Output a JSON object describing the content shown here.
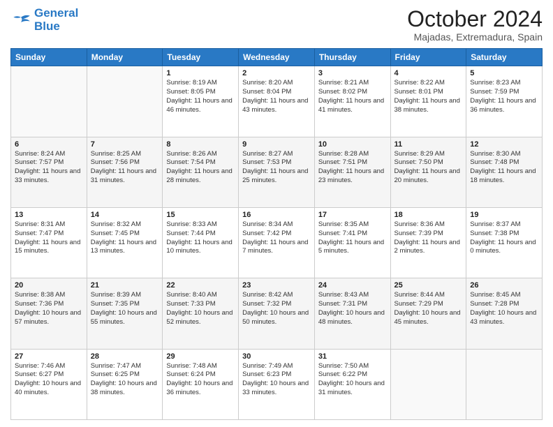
{
  "logo": {
    "text1": "General",
    "text2": "Blue"
  },
  "title": "October 2024",
  "subtitle": "Majadas, Extremadura, Spain",
  "days_of_week": [
    "Sunday",
    "Monday",
    "Tuesday",
    "Wednesday",
    "Thursday",
    "Friday",
    "Saturday"
  ],
  "weeks": [
    [
      {
        "day": "",
        "sunrise": "",
        "sunset": "",
        "daylight": ""
      },
      {
        "day": "",
        "sunrise": "",
        "sunset": "",
        "daylight": ""
      },
      {
        "day": "1",
        "sunrise": "Sunrise: 8:19 AM",
        "sunset": "Sunset: 8:05 PM",
        "daylight": "Daylight: 11 hours and 46 minutes."
      },
      {
        "day": "2",
        "sunrise": "Sunrise: 8:20 AM",
        "sunset": "Sunset: 8:04 PM",
        "daylight": "Daylight: 11 hours and 43 minutes."
      },
      {
        "day": "3",
        "sunrise": "Sunrise: 8:21 AM",
        "sunset": "Sunset: 8:02 PM",
        "daylight": "Daylight: 11 hours and 41 minutes."
      },
      {
        "day": "4",
        "sunrise": "Sunrise: 8:22 AM",
        "sunset": "Sunset: 8:01 PM",
        "daylight": "Daylight: 11 hours and 38 minutes."
      },
      {
        "day": "5",
        "sunrise": "Sunrise: 8:23 AM",
        "sunset": "Sunset: 7:59 PM",
        "daylight": "Daylight: 11 hours and 36 minutes."
      }
    ],
    [
      {
        "day": "6",
        "sunrise": "Sunrise: 8:24 AM",
        "sunset": "Sunset: 7:57 PM",
        "daylight": "Daylight: 11 hours and 33 minutes."
      },
      {
        "day": "7",
        "sunrise": "Sunrise: 8:25 AM",
        "sunset": "Sunset: 7:56 PM",
        "daylight": "Daylight: 11 hours and 31 minutes."
      },
      {
        "day": "8",
        "sunrise": "Sunrise: 8:26 AM",
        "sunset": "Sunset: 7:54 PM",
        "daylight": "Daylight: 11 hours and 28 minutes."
      },
      {
        "day": "9",
        "sunrise": "Sunrise: 8:27 AM",
        "sunset": "Sunset: 7:53 PM",
        "daylight": "Daylight: 11 hours and 25 minutes."
      },
      {
        "day": "10",
        "sunrise": "Sunrise: 8:28 AM",
        "sunset": "Sunset: 7:51 PM",
        "daylight": "Daylight: 11 hours and 23 minutes."
      },
      {
        "day": "11",
        "sunrise": "Sunrise: 8:29 AM",
        "sunset": "Sunset: 7:50 PM",
        "daylight": "Daylight: 11 hours and 20 minutes."
      },
      {
        "day": "12",
        "sunrise": "Sunrise: 8:30 AM",
        "sunset": "Sunset: 7:48 PM",
        "daylight": "Daylight: 11 hours and 18 minutes."
      }
    ],
    [
      {
        "day": "13",
        "sunrise": "Sunrise: 8:31 AM",
        "sunset": "Sunset: 7:47 PM",
        "daylight": "Daylight: 11 hours and 15 minutes."
      },
      {
        "day": "14",
        "sunrise": "Sunrise: 8:32 AM",
        "sunset": "Sunset: 7:45 PM",
        "daylight": "Daylight: 11 hours and 13 minutes."
      },
      {
        "day": "15",
        "sunrise": "Sunrise: 8:33 AM",
        "sunset": "Sunset: 7:44 PM",
        "daylight": "Daylight: 11 hours and 10 minutes."
      },
      {
        "day": "16",
        "sunrise": "Sunrise: 8:34 AM",
        "sunset": "Sunset: 7:42 PM",
        "daylight": "Daylight: 11 hours and 7 minutes."
      },
      {
        "day": "17",
        "sunrise": "Sunrise: 8:35 AM",
        "sunset": "Sunset: 7:41 PM",
        "daylight": "Daylight: 11 hours and 5 minutes."
      },
      {
        "day": "18",
        "sunrise": "Sunrise: 8:36 AM",
        "sunset": "Sunset: 7:39 PM",
        "daylight": "Daylight: 11 hours and 2 minutes."
      },
      {
        "day": "19",
        "sunrise": "Sunrise: 8:37 AM",
        "sunset": "Sunset: 7:38 PM",
        "daylight": "Daylight: 11 hours and 0 minutes."
      }
    ],
    [
      {
        "day": "20",
        "sunrise": "Sunrise: 8:38 AM",
        "sunset": "Sunset: 7:36 PM",
        "daylight": "Daylight: 10 hours and 57 minutes."
      },
      {
        "day": "21",
        "sunrise": "Sunrise: 8:39 AM",
        "sunset": "Sunset: 7:35 PM",
        "daylight": "Daylight: 10 hours and 55 minutes."
      },
      {
        "day": "22",
        "sunrise": "Sunrise: 8:40 AM",
        "sunset": "Sunset: 7:33 PM",
        "daylight": "Daylight: 10 hours and 52 minutes."
      },
      {
        "day": "23",
        "sunrise": "Sunrise: 8:42 AM",
        "sunset": "Sunset: 7:32 PM",
        "daylight": "Daylight: 10 hours and 50 minutes."
      },
      {
        "day": "24",
        "sunrise": "Sunrise: 8:43 AM",
        "sunset": "Sunset: 7:31 PM",
        "daylight": "Daylight: 10 hours and 48 minutes."
      },
      {
        "day": "25",
        "sunrise": "Sunrise: 8:44 AM",
        "sunset": "Sunset: 7:29 PM",
        "daylight": "Daylight: 10 hours and 45 minutes."
      },
      {
        "day": "26",
        "sunrise": "Sunrise: 8:45 AM",
        "sunset": "Sunset: 7:28 PM",
        "daylight": "Daylight: 10 hours and 43 minutes."
      }
    ],
    [
      {
        "day": "27",
        "sunrise": "Sunrise: 7:46 AM",
        "sunset": "Sunset: 6:27 PM",
        "daylight": "Daylight: 10 hours and 40 minutes."
      },
      {
        "day": "28",
        "sunrise": "Sunrise: 7:47 AM",
        "sunset": "Sunset: 6:25 PM",
        "daylight": "Daylight: 10 hours and 38 minutes."
      },
      {
        "day": "29",
        "sunrise": "Sunrise: 7:48 AM",
        "sunset": "Sunset: 6:24 PM",
        "daylight": "Daylight: 10 hours and 36 minutes."
      },
      {
        "day": "30",
        "sunrise": "Sunrise: 7:49 AM",
        "sunset": "Sunset: 6:23 PM",
        "daylight": "Daylight: 10 hours and 33 minutes."
      },
      {
        "day": "31",
        "sunrise": "Sunrise: 7:50 AM",
        "sunset": "Sunset: 6:22 PM",
        "daylight": "Daylight: 10 hours and 31 minutes."
      },
      {
        "day": "",
        "sunrise": "",
        "sunset": "",
        "daylight": ""
      },
      {
        "day": "",
        "sunrise": "",
        "sunset": "",
        "daylight": ""
      }
    ]
  ]
}
